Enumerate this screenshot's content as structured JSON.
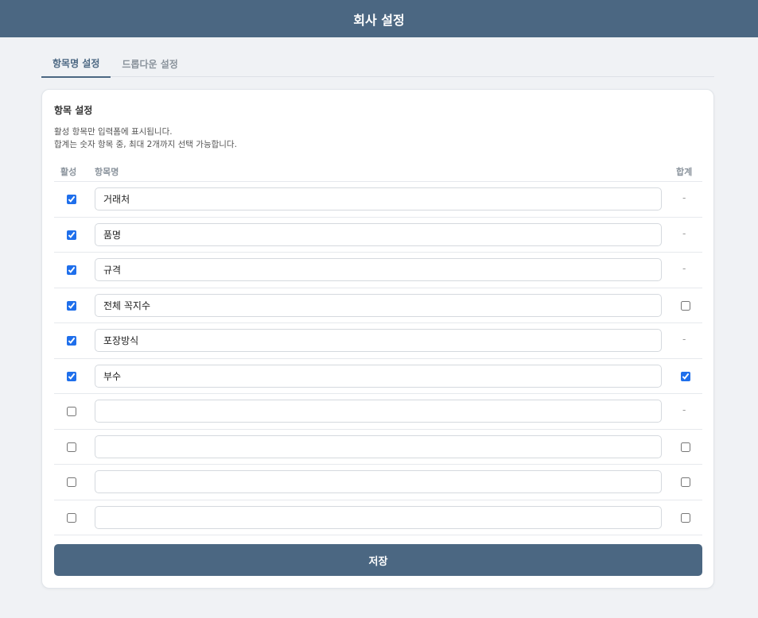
{
  "header": {
    "title": "회사 설정"
  },
  "tabs": [
    {
      "label": "항목명 설정",
      "active": true
    },
    {
      "label": "드롭다운 설정",
      "active": false
    }
  ],
  "section": {
    "title": "항목 설정",
    "description_lines": [
      "활성 항목만 입력폼에 표시됩니다.",
      "합계는 숫자 항목 중, 최대 2개까지 선택 가능합니다."
    ]
  },
  "table": {
    "headers": {
      "active": "활성",
      "name": "항목명",
      "sum": "합계"
    },
    "rows": [
      {
        "active": true,
        "name": "거래처",
        "sum": "-"
      },
      {
        "active": true,
        "name": "품명",
        "sum": "-"
      },
      {
        "active": true,
        "name": "규격",
        "sum": "-"
      },
      {
        "active": true,
        "name": "전체 꼭지수",
        "sum": false
      },
      {
        "active": true,
        "name": "포장방식",
        "sum": "-"
      },
      {
        "active": true,
        "name": "부수",
        "sum": true
      },
      {
        "active": false,
        "name": "",
        "sum": "-"
      },
      {
        "active": false,
        "name": "",
        "sum": false
      },
      {
        "active": false,
        "name": "",
        "sum": false
      },
      {
        "active": false,
        "name": "",
        "sum": false
      }
    ]
  },
  "actions": {
    "save_label": "저장"
  },
  "colors": {
    "primary": "#4b6782",
    "checkbox": "#1f6feb"
  }
}
